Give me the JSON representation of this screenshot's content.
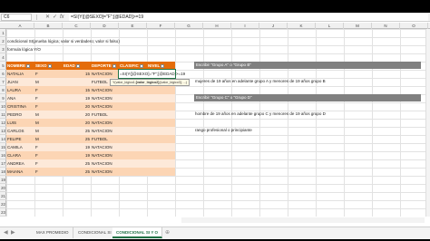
{
  "formula_bar": {
    "name_box": "C6",
    "cancel_symbol": "✕",
    "enter_symbol": "✓",
    "fx_label": "fx",
    "formula": "=SI(Y([@SEXO]=\"F\";[@EDAD]>=19"
  },
  "columns": [
    "A",
    "B",
    "C",
    "D",
    "E",
    "F",
    "G",
    "H",
    "I",
    "J",
    "K",
    "L",
    "M",
    "N",
    "O"
  ],
  "rows": [
    "1",
    "2",
    "3",
    "4",
    "5",
    "6",
    "7",
    "8",
    "9",
    "10",
    "11",
    "12",
    "13",
    "14",
    "15",
    "16",
    "17",
    "18",
    "19",
    "20",
    "21",
    "22",
    "23"
  ],
  "notes": {
    "row2": "condicional SI(prueba lógica; valor si verdadero; valor si falso)",
    "row3": "formula lógica Y/O"
  },
  "table": {
    "headers": [
      "NOMBRE",
      "SEXO",
      "EDAD",
      "DEPORTE",
      "CLASIFIC",
      "NIVEL"
    ],
    "rows": [
      [
        "NATALIA",
        "F",
        "15",
        "NATACION"
      ],
      [
        "JUAN",
        "M",
        "",
        "FUTBOL"
      ],
      [
        "LAURA",
        "F",
        "15",
        "NATACION"
      ],
      [
        "ANA",
        "F",
        "19",
        "NATACION"
      ],
      [
        "CRISTINA",
        "F",
        "20",
        "NATACION"
      ],
      [
        "PEDRO",
        "M",
        "20",
        "FUTBOL"
      ],
      [
        "LUIS",
        "M",
        "20",
        "NATACION"
      ],
      [
        "CARLOS",
        "M",
        "25",
        "NATACION"
      ],
      [
        "FELIPE",
        "M",
        "25",
        "FUTBOL"
      ],
      [
        "CAMILA",
        "F",
        "19",
        "NATACION"
      ],
      [
        "CLARA",
        "F",
        "19",
        "NATACION"
      ],
      [
        "ANDREA",
        "F",
        "25",
        "NATACION"
      ],
      [
        "MAIANA",
        "F",
        "25",
        "NATACION"
      ]
    ],
    "editing_formula": "=SI(Y([@SEXO]=\"F\";[@EDAD]>=19",
    "tooltip_parts": [
      "Y(valor_lógico1;",
      "[valor_lógico2];",
      "[valor_lógico3]; ...)"
    ]
  },
  "right_panel": {
    "bar1": "Escribir \"Grupo A\" o \"Grupo B\"",
    "line1": "mujeres de 19 años en adelante grupo A y menores de 19 años grupo B",
    "bar2": "Escribir \"Grupo C\" o \"Grupo D\"",
    "line2": "hombre de 19 años en adelante grupo C y menores de 19 años grupo D",
    "line3": "rango profesional o principiante"
  },
  "tabs": [
    "MAX PROMEDIO",
    "CONDICIONAL SI",
    "CONDICIONAL SI Y O"
  ],
  "active_tab_index": 2,
  "colors": {
    "header_orange": "#e46c0a",
    "band_dark": "#fcd5b4",
    "band_light": "#fde9d9",
    "excel_green": "#217346",
    "gray_bar": "#808080"
  }
}
